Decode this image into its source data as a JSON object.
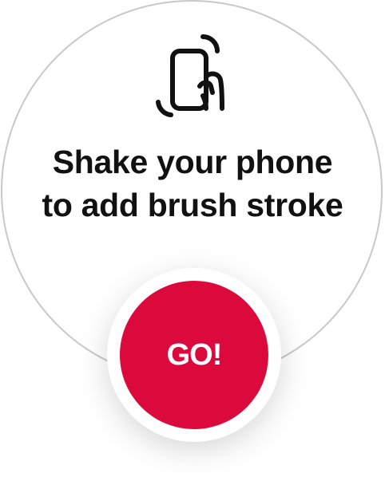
{
  "card": {
    "icon": "shake-phone-icon",
    "instruction_line1": "Shake your phone",
    "instruction_line2": "to add brush stroke"
  },
  "go_button": {
    "label": "GO!"
  },
  "colors": {
    "accent": "#dc0a3c",
    "circle_border": "#c8c8c8",
    "text": "#111111",
    "background": "#ffffff"
  }
}
